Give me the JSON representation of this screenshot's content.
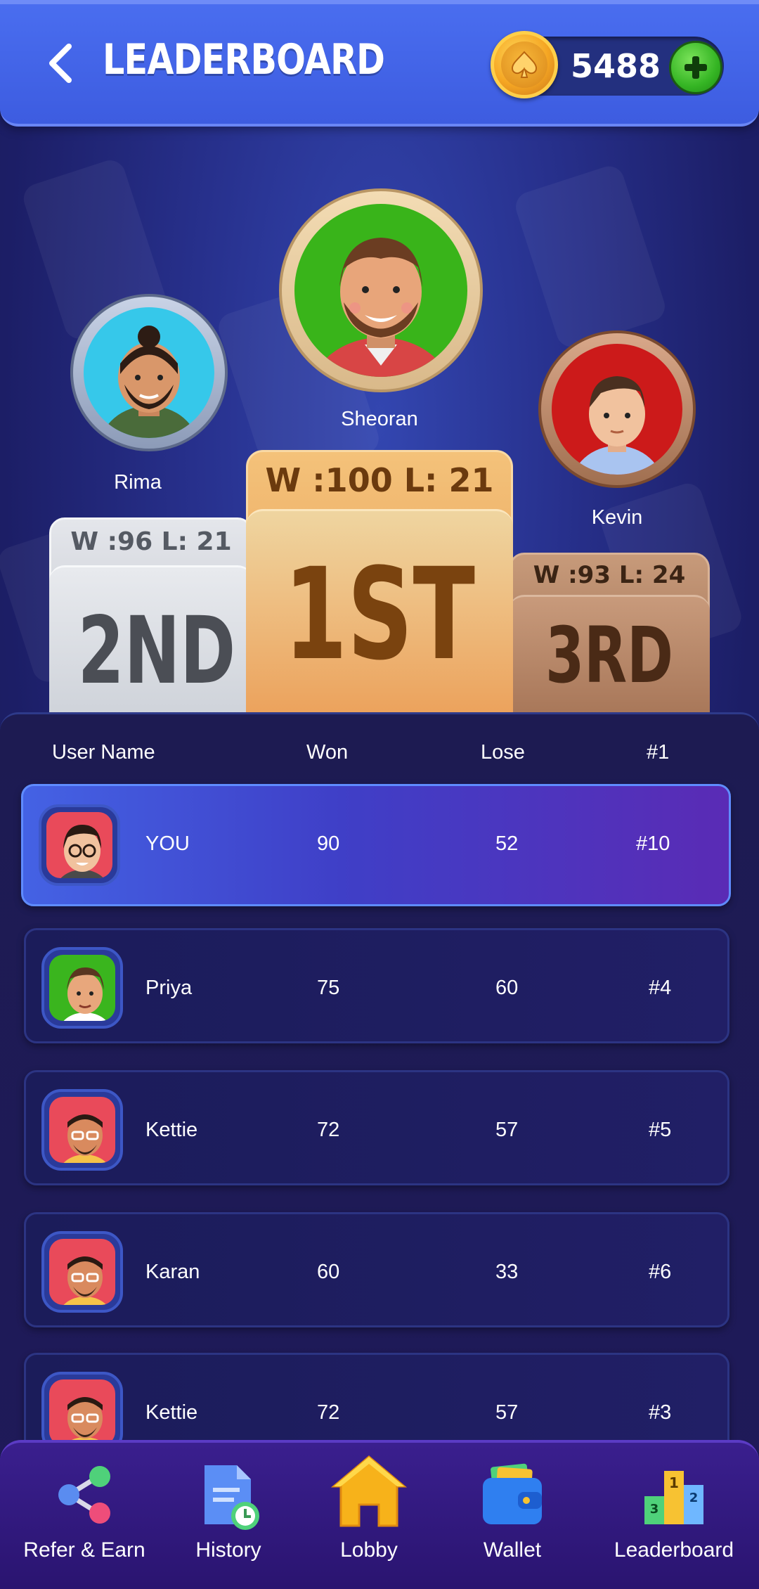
{
  "header": {
    "title": "LEADERBOARD",
    "coin_balance": "5488"
  },
  "podium": {
    "first": {
      "name": "Sheoran",
      "stats": "W :100 L: 21",
      "rank": "1ST"
    },
    "second": {
      "name": "Rima",
      "stats": "W :96 L: 21",
      "rank": "2ND"
    },
    "third": {
      "name": "Kevin",
      "stats": "W :93 L: 24",
      "rank": "3RD"
    }
  },
  "table": {
    "columns": [
      "User Name",
      "Won",
      "Lose",
      "#1"
    ],
    "rows": [
      {
        "name": "YOU",
        "won": "90",
        "lose": "52",
        "rank": "#10",
        "highlight": true
      },
      {
        "name": "Priya",
        "won": "75",
        "lose": "60",
        "rank": "#4"
      },
      {
        "name": "Kettie",
        "won": "72",
        "lose": "57",
        "rank": "#5"
      },
      {
        "name": "Karan",
        "won": "60",
        "lose": "33",
        "rank": "#6"
      },
      {
        "name": "Kettie",
        "won": "72",
        "lose": "57",
        "rank": "#3"
      }
    ]
  },
  "nav": [
    {
      "label": "Refer & Earn",
      "icon": "share-icon"
    },
    {
      "label": "History",
      "icon": "document-clock-icon"
    },
    {
      "label": "Lobby",
      "icon": "home-icon"
    },
    {
      "label": "Wallet",
      "icon": "wallet-icon"
    },
    {
      "label": "Leaderboard",
      "icon": "podium-icon"
    }
  ],
  "colors": {
    "header": "#3d5ce0",
    "gold_block": "#f0b36a",
    "silver_block": "#d9dce2",
    "bronze_block": "#b98a6d",
    "highlight_row": "#4462e4",
    "nav_bg": "#3a1f8e"
  }
}
